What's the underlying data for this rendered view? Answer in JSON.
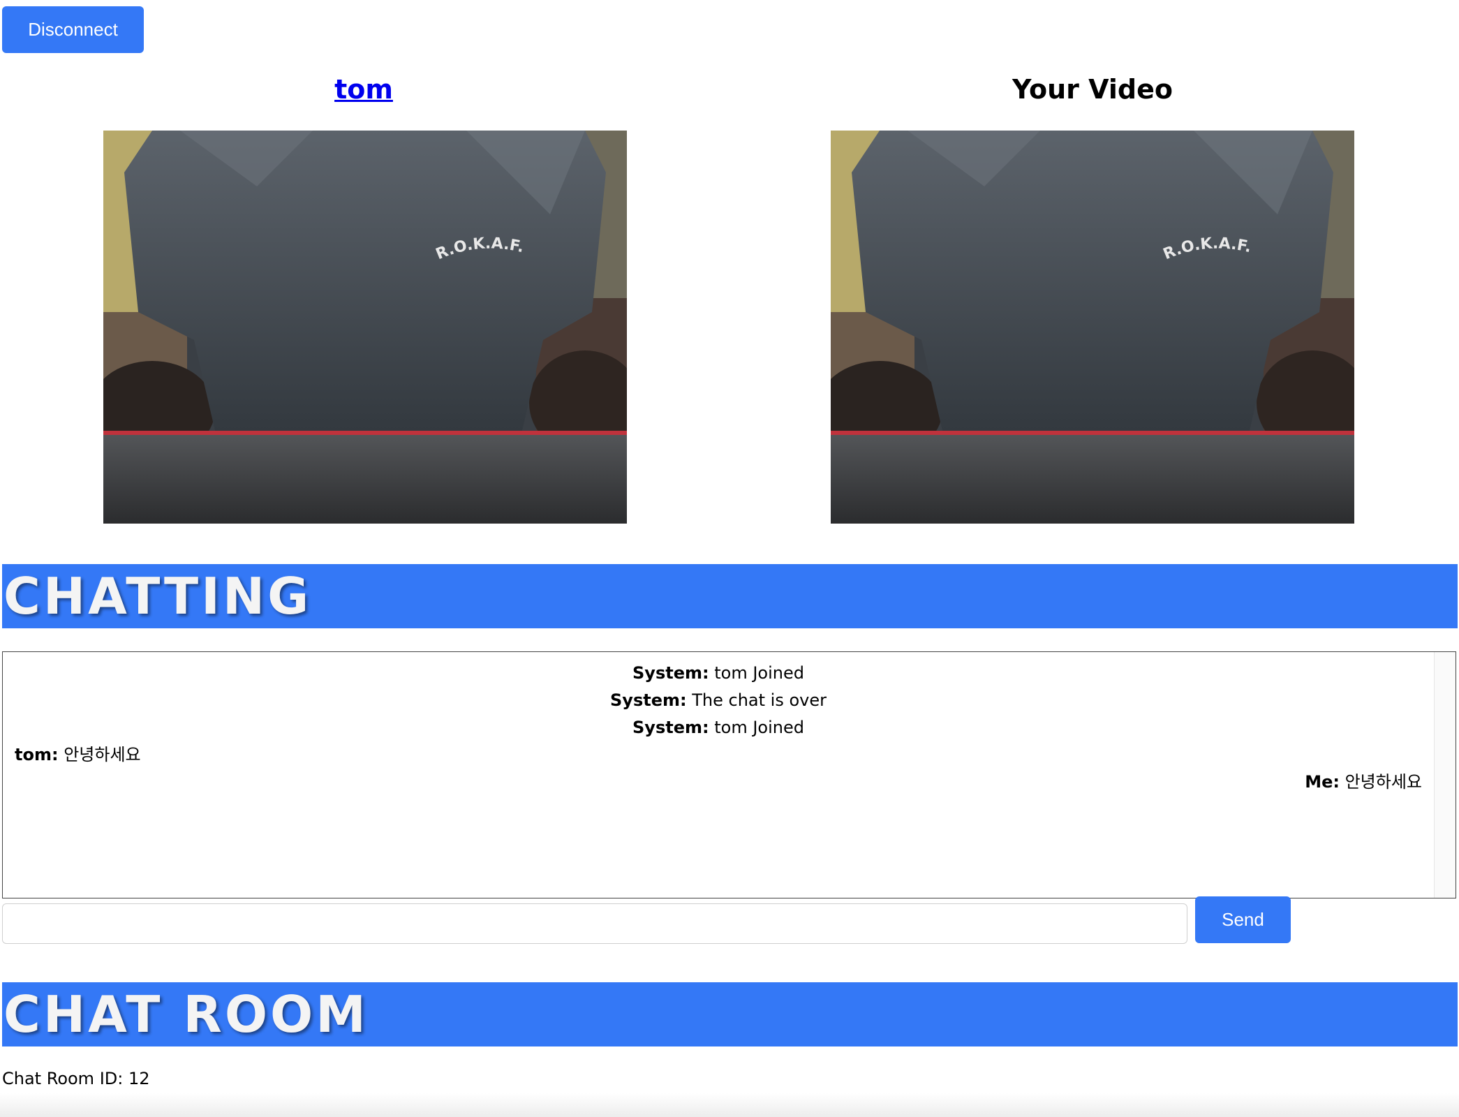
{
  "toolbar": {
    "disconnect_label": "Disconnect"
  },
  "videos": {
    "remote": {
      "title": "tom"
    },
    "local": {
      "title": "Your Video"
    },
    "frame_shirt_text": "R.O.K.A.F."
  },
  "chatting": {
    "heading": "CHATTING",
    "messages": [
      {
        "sender": "System:",
        "text": "tom Joined",
        "align": "center"
      },
      {
        "sender": "System:",
        "text": "The chat is over",
        "align": "center"
      },
      {
        "sender": "System:",
        "text": "tom Joined",
        "align": "center"
      },
      {
        "sender": "tom:",
        "text": "안녕하세요",
        "align": "left"
      },
      {
        "sender": "Me:",
        "text": "안녕하세요",
        "align": "right"
      }
    ],
    "input_value": "",
    "send_label": "Send"
  },
  "chat_room": {
    "heading": "CHAT ROOM",
    "id_label": "Chat Room ID: 12"
  },
  "colors": {
    "accent": "#3478f6",
    "link": "#0000ee"
  }
}
